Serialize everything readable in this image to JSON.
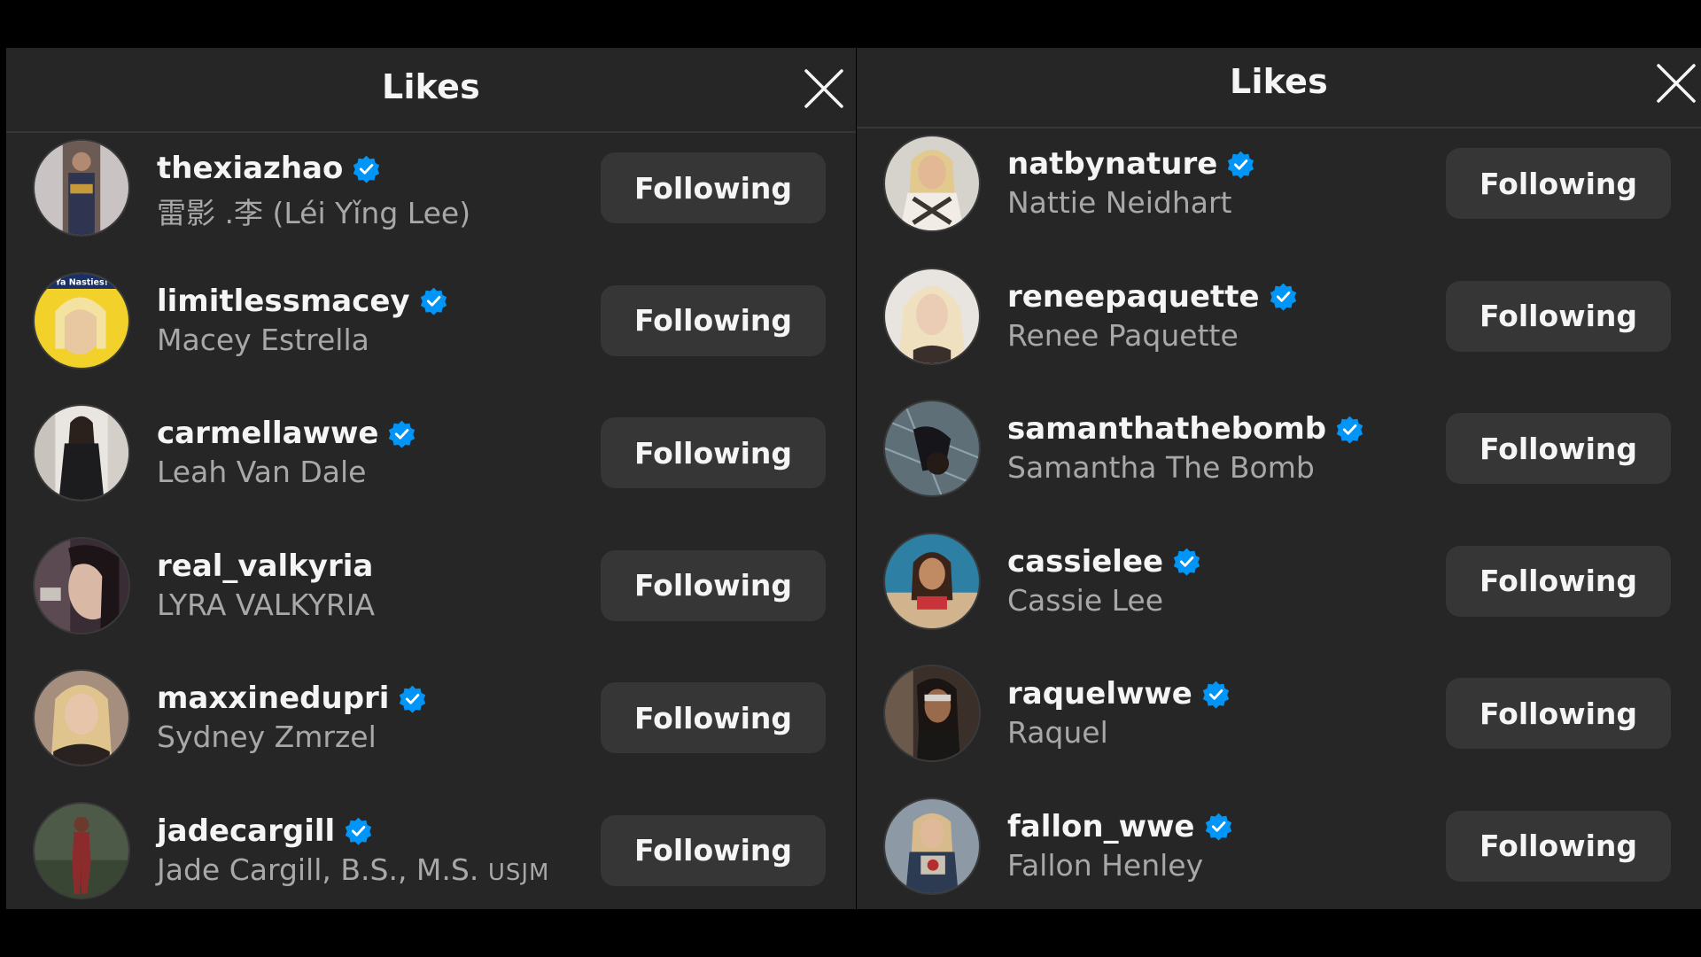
{
  "left_panel": {
    "title": "Likes",
    "users": [
      {
        "username": "thexiazhao",
        "full_name": "雷影 .李 (Léi Yǐng Lee)",
        "verified": true,
        "button": "Following"
      },
      {
        "username": "limitlessmacey",
        "full_name": "Macey Estrella",
        "verified": true,
        "button": "Following",
        "avatar_text": "Ya Nasties!"
      },
      {
        "username": "carmellawwe",
        "full_name": "Leah Van Dale",
        "verified": true,
        "button": "Following"
      },
      {
        "username": "real_valkyria",
        "full_name": "LYRA VALKYRIA",
        "verified": false,
        "button": "Following"
      },
      {
        "username": "maxxinedupri",
        "full_name": "Sydney Zmrzel",
        "verified": true,
        "button": "Following"
      },
      {
        "username": "jadecargill",
        "full_name": "Jade Cargill, B.S., M.S.",
        "full_name_suffix": "USJM",
        "verified": true,
        "button": "Following"
      }
    ]
  },
  "right_panel": {
    "title": "Likes",
    "users": [
      {
        "username": "natbynature",
        "full_name": "Nattie Neidhart",
        "verified": true,
        "button": "Following"
      },
      {
        "username": "reneepaquette",
        "full_name": "Renee Paquette",
        "verified": true,
        "button": "Following"
      },
      {
        "username": "samanthathebomb",
        "full_name": "Samantha The Bomb",
        "verified": true,
        "button": "Following"
      },
      {
        "username": "cassielee",
        "full_name": "Cassie Lee",
        "verified": true,
        "button": "Following"
      },
      {
        "username": "raquelwwe",
        "full_name": "Raquel",
        "verified": true,
        "button": "Following"
      },
      {
        "username": "fallon_wwe",
        "full_name": "Fallon Henley",
        "verified": true,
        "button": "Following"
      }
    ]
  },
  "icons": {
    "close": "close-icon",
    "verified": "verified-badge-icon"
  },
  "colors": {
    "background": "#000000",
    "panel": "#262626",
    "button": "#363636",
    "primary_text": "#f5f5f5",
    "secondary_text": "#a8a8a8",
    "verified": "#0095f6"
  }
}
